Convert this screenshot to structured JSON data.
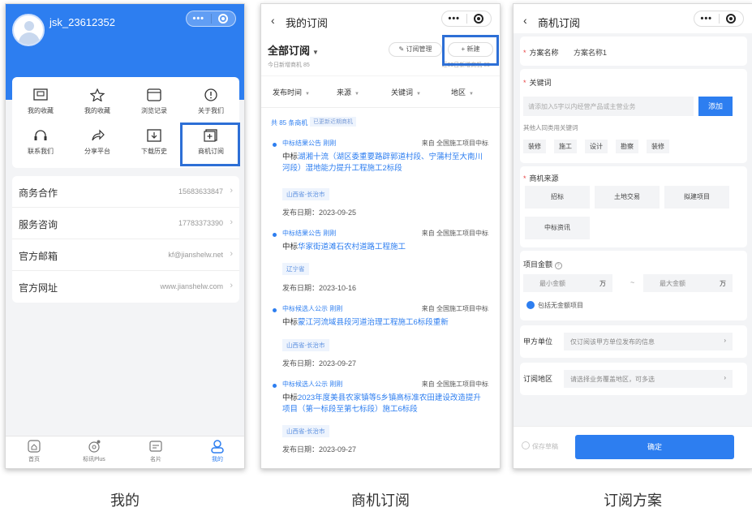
{
  "captions": [
    "我的",
    "商机订阅",
    "订阅方案"
  ],
  "capsule": {
    "dots": "•••"
  },
  "p1": {
    "username": "jsk_23612352",
    "grid": [
      {
        "label": "我的收藏",
        "icon": "bookmark-icon"
      },
      {
        "label": "我的收藏",
        "icon": "star-icon"
      },
      {
        "label": "浏览记录",
        "icon": "browser-icon"
      },
      {
        "label": "关于我们",
        "icon": "info-icon"
      },
      {
        "label": "联系我们",
        "icon": "headset-icon"
      },
      {
        "label": "分享平台",
        "icon": "share-icon"
      },
      {
        "label": "下载历史",
        "icon": "download-icon"
      },
      {
        "label": "商机订阅",
        "icon": "subscribe-icon"
      }
    ],
    "list": [
      {
        "key": "商务合作",
        "value": "15683633847"
      },
      {
        "key": "服务咨询",
        "value": "17783373390"
      },
      {
        "key": "官方邮箱",
        "value": "kf@jianshelw.net"
      },
      {
        "key": "官方网址",
        "value": "www.jianshelw.com"
      }
    ],
    "tabs": [
      {
        "label": "首页",
        "icon": "home-icon"
      },
      {
        "label": "标讯Plus",
        "icon": "plus-icon"
      },
      {
        "label": "名片",
        "icon": "card-icon"
      },
      {
        "label": "我的",
        "icon": "user-icon"
      }
    ],
    "accent": "#2d7ef0"
  },
  "p2": {
    "back": "‹",
    "title": "我的订阅",
    "all": "全部订阅",
    "caret": "▼",
    "today": "今日新增商机 85",
    "recent": "近30日新增商机 85",
    "manage": "✎ 订阅管理",
    "new": "+ 新建",
    "filters": [
      "发布时间",
      "来源",
      "关键词",
      "地区"
    ],
    "filter_caret": "▼",
    "count": "共 85 条商机",
    "count_tag": "已更新近期商机",
    "items": [
      {
        "type": "中标结果公告  刚刚",
        "src": "来自 全国施工项目中标",
        "pre": "中标",
        "title": "湖湘十流（湖区委重要路辟郭道村段、宁蒲村至大南川河段）湿地能力提升工程施工2标段",
        "region": "山西省-长治市",
        "date": "发布日期：2023-09-25"
      },
      {
        "type": "中标结果公告  刚刚",
        "src": "来自 全国施工项目中标",
        "pre": "中标",
        "title": "华家街道滩石农村道路工程施工",
        "region": "辽宁省",
        "date": "发布日期：2023-10-16"
      },
      {
        "type": "中标候选人公示  刚刚",
        "src": "来自 全国施工项目中标",
        "pre": "中标",
        "title": "蒙江河流域县段河道治理工程施工6标段重新",
        "region": "山西省-长治市",
        "date": "发布日期：2023-09-27"
      },
      {
        "type": "中标候选人公示  刚刚",
        "src": "来自 全国施工项目中标",
        "pre": "中标",
        "title": "2023年度美县农家镇等5乡镇高标准农田建设改造提升项目（第一标段至第七标段）施工6标段",
        "region": "山西省-长治市",
        "date": "发布日期：2023-09-27"
      }
    ]
  },
  "p3": {
    "back": "‹",
    "title": "商机订阅",
    "plan_label": "方案名称",
    "plan_value": "方案名称1",
    "kw_label": "关键词",
    "kw_placeholder": "请添加入5字以内经营产品或主营业务",
    "kw_add": "添加",
    "kw_hint": "其他人同类用关键词",
    "kw_tags": [
      "装修",
      "施工",
      "设计",
      "勘察",
      "装修"
    ],
    "source_label": "商机来源",
    "sources": [
      "招标",
      "土地交易",
      "拟建项目",
      "中标资讯"
    ],
    "amount_label": "项目金额",
    "amount_min": "最小金额",
    "amount_max": "最大金额",
    "amount_unit": "万",
    "amount_sep": "~",
    "amount_check": "包括无金额项目",
    "party_label": "甲方单位",
    "party_placeholder": "仅订阅该甲方单位发布的信息",
    "region_label": "订阅地区",
    "region_placeholder": "请选择业务覆盖地区，可多选",
    "arrow": "›",
    "save_draft": "保存草稿",
    "confirm": "确定"
  }
}
